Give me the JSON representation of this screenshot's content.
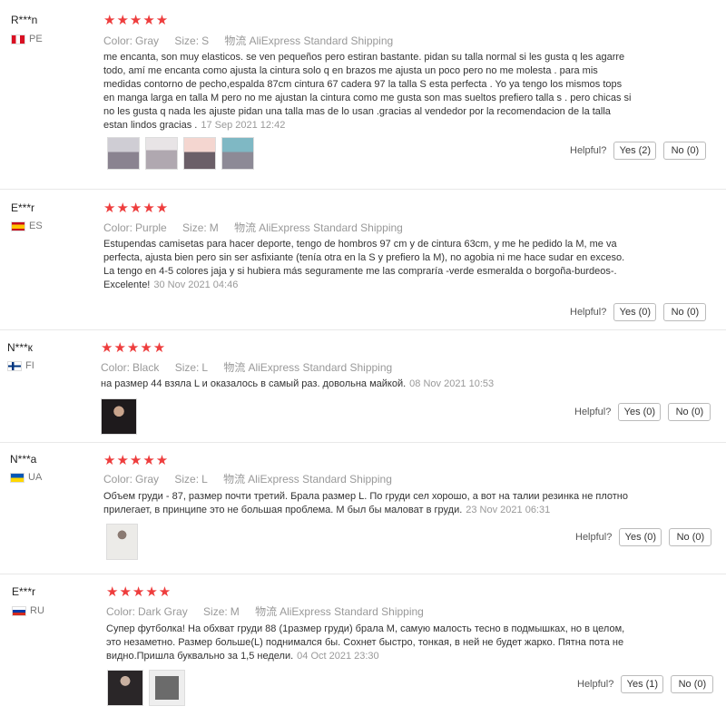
{
  "labels": {
    "color": "Color:",
    "size": "Size:",
    "shipping_key": "物流",
    "helpful": "Helpful?"
  },
  "reviews": [
    {
      "user": "R***n",
      "country": "PE",
      "flag": "flag-peru-icon",
      "stars": "★★★★★",
      "color": "Gray",
      "size": "S",
      "shipping": "AliExpress Standard Shipping",
      "text": "me encanta, son muy elasticos. se ven pequeños pero estiran bastante. pidan su talla normal si les gusta q les agarre todo, amí me encanta como ajusta la cintura solo q en brazos me ajusta un poco pero no me molesta . para mis medidas contorno de pecho,espalda 87cm cintura 67 cadera 97 la talla S esta perfecta . Yo ya tengo los mismos tops en manga larga en talla M pero no me ajustan la cintura como me gusta son mas sueltos prefiero talla s . pero chicas si no les gusta q nada les ajuste pidan una talla mas de lo usan .gracias al vendedor por la recomendacion de la talla estan lindos gracias .",
      "date": "17 Sep 2021 12:42",
      "yes": "Yes (2)",
      "no": "No (0)"
    },
    {
      "user": "E***r",
      "country": "ES",
      "flag": "flag-spain-icon",
      "stars": "★★★★★",
      "color": "Purple",
      "size": "M",
      "shipping": "AliExpress Standard Shipping",
      "text": "Estupendas camisetas para hacer deporte, tengo de hombros 97 cm y de cintura 63cm, y me he pedido la M, me va perfecta, ajusta bien pero sin ser asfixiante (tenía otra en la S y prefiero la M), no agobia ni me hace sudar en exceso. La tengo en 4-5 colores jaja y si hubiera más seguramente me las compraría -verde esmeralda o borgoña-burdeos-. Excelente!",
      "date": "30 Nov 2021 04:46",
      "yes": "Yes (0)",
      "no": "No (0)"
    },
    {
      "user": "N***к",
      "country": "FI",
      "flag": "flag-finland-icon",
      "stars": "★★★★★",
      "color": "Black",
      "size": "L",
      "shipping": "AliExpress Standard Shipping",
      "text": "на размер 44 взяла L и оказалось в самый раз. довольна майкой.",
      "date": "08 Nov 2021 10:53",
      "yes": "Yes (0)",
      "no": "No (0)"
    },
    {
      "user": "N***a",
      "country": "UA",
      "flag": "flag-ukraine-icon",
      "stars": "★★★★★",
      "color": "Gray",
      "size": "L",
      "shipping": "AliExpress Standard Shipping",
      "text": "Объем груди - 87, размер почти третий. Брала размер L. По груди сел хорошо, а вот на талии резинка не плотно прилегает, в принципе это не большая проблема. М был бы маловат в груди.",
      "date": "23 Nov 2021 06:31",
      "yes": "Yes (0)",
      "no": "No (0)"
    },
    {
      "user": "E***r",
      "country": "RU",
      "flag": "flag-russia-icon",
      "stars": "★★★★★",
      "color": "Dark Gray",
      "size": "M",
      "shipping": "AliExpress Standard Shipping",
      "text": "Супер футболка! На обхват груди 88 (1размер груди) брала М, самую малость тесно в подмышках, но в целом, это незаметно. Размер больше(L) поднимался бы. Сохнет быстро, тонкая, в ней не будет жарко. Пятна пота не видно.Пришла буквально за 1,5 недели.",
      "date": "04 Oct 2021 23:30",
      "yes": "Yes (1)",
      "no": "No (0)"
    }
  ]
}
